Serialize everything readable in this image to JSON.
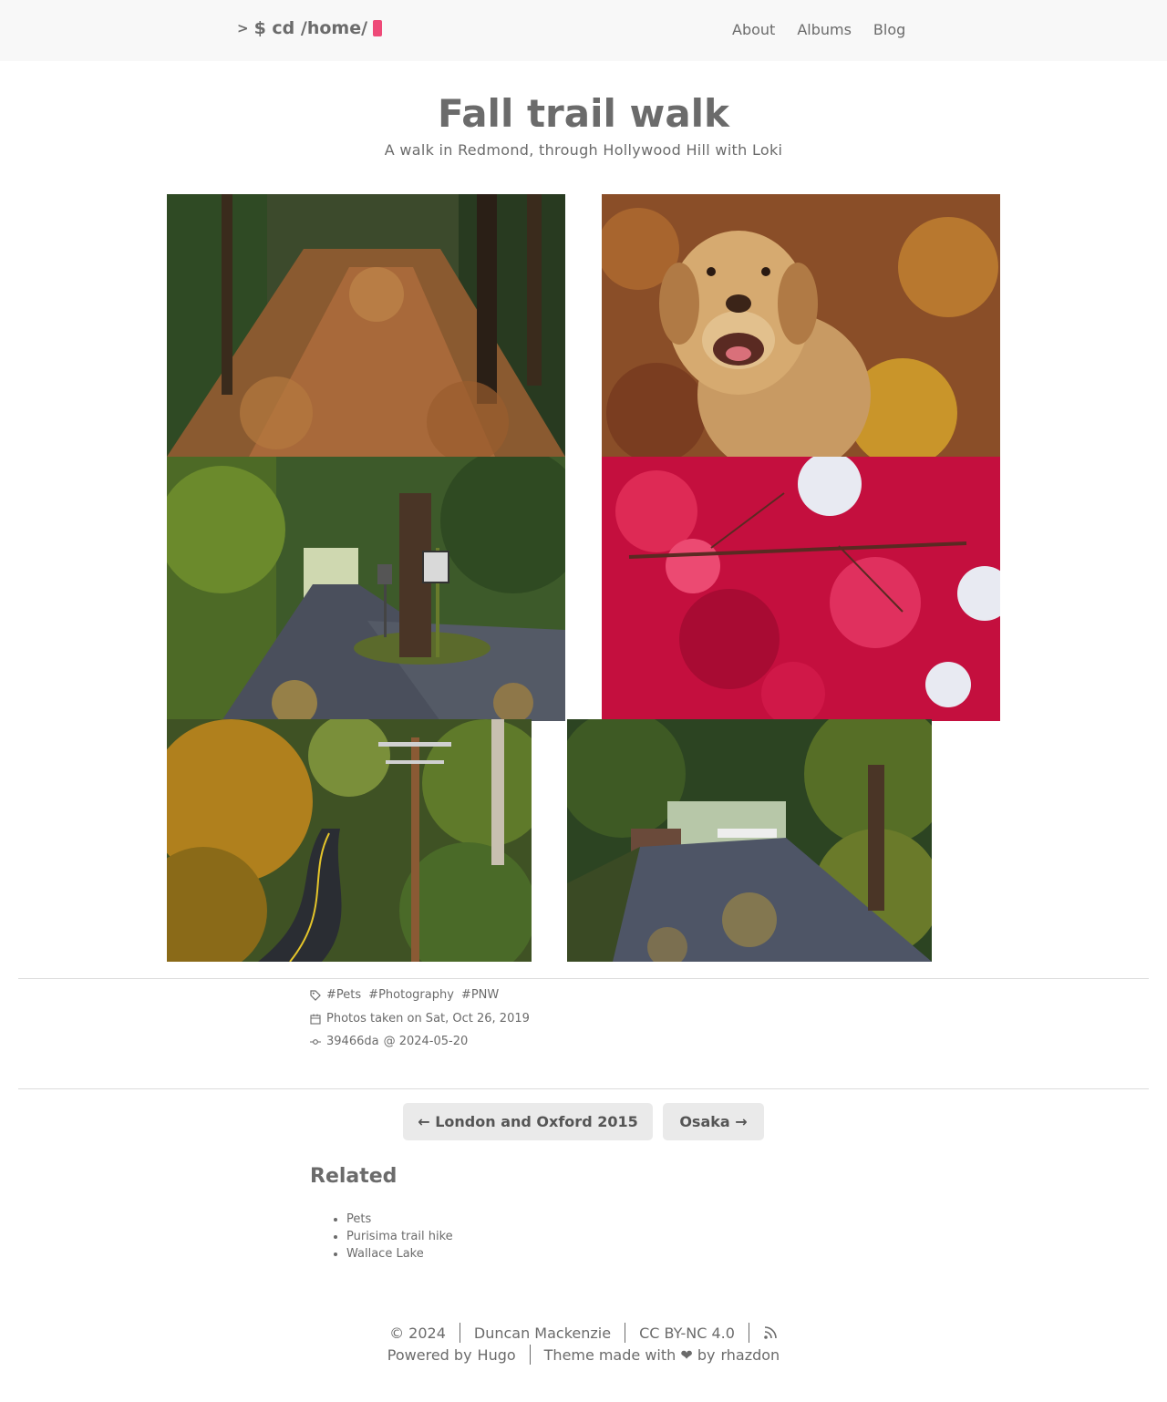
{
  "header": {
    "logo_prompt": ">",
    "logo_text": "$ cd /home/",
    "nav": [
      "About",
      "Albums",
      "Blog"
    ]
  },
  "page": {
    "title": "Fall trail walk",
    "subtitle": "A walk in Redmond, through Hollywood Hill with Loki"
  },
  "photos": [
    {
      "name": "photo-forest-trail-leaves"
    },
    {
      "name": "photo-dog-loki"
    },
    {
      "name": "photo-road-tree-sign"
    },
    {
      "name": "photo-red-maple-leaves"
    },
    {
      "name": "photo-winding-road-pole"
    },
    {
      "name": "photo-leafy-lane"
    }
  ],
  "meta": {
    "tag_prefix": "#",
    "tags": [
      "Pets",
      "Photography",
      "PNW"
    ],
    "date_text": "Photos taken on Sat, Oct 26, 2019",
    "commit": "39466da",
    "commit_date": "@ 2024-05-20"
  },
  "pager": {
    "prev": "← London and Oxford 2015",
    "next": "Osaka →"
  },
  "related": {
    "heading": "Related",
    "items": [
      "Pets",
      "Purisima trail hike",
      "Wallace Lake"
    ]
  },
  "footer": {
    "copyright": "© 2024",
    "author": "Duncan Mackenzie",
    "license": "CC BY-NC 4.0",
    "powered_prefix": "Powered by",
    "hugo": "Hugo",
    "theme": "Theme",
    "made_with": "made with ❤ by",
    "theme_author": "rhazdon"
  },
  "colors": {
    "header_bg": "#f8f8f8",
    "cursor_accent": "#ee4a78",
    "text": "#6b6b6b",
    "button_bg": "#eaeaea"
  }
}
